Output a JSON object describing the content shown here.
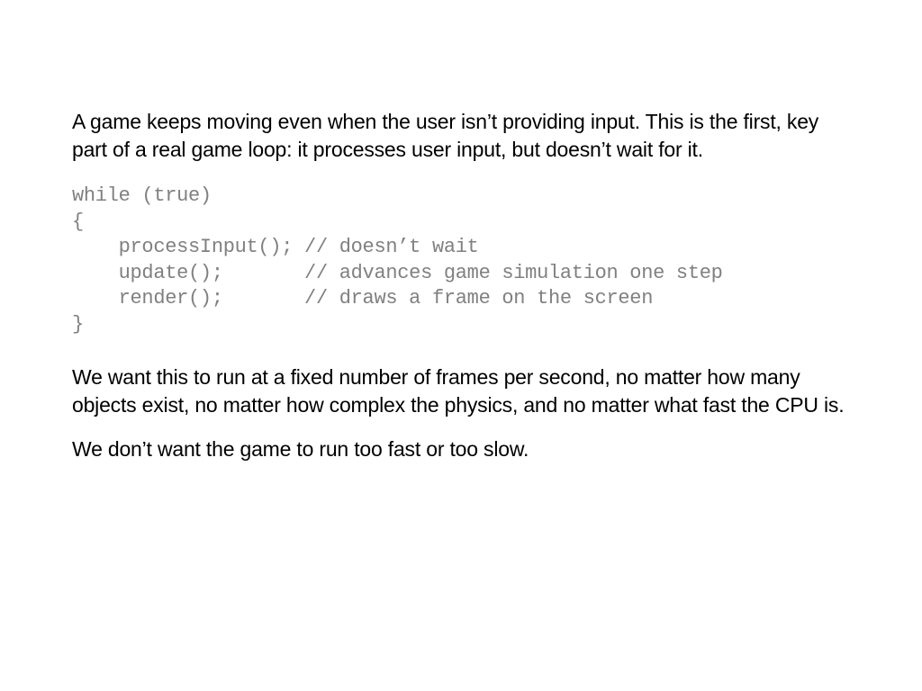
{
  "para1": "A game keeps moving even when the user isn’t providing input.  This is the first, key part of a real game loop: it processes user input, but doesn’t wait for it.",
  "code": "while (true)\n{\n    processInput(); // doesn’t wait\n    update();       // advances game simulation one step\n    render();       // draws a frame on the screen\n}",
  "para2": "We want this to run at a fixed number of frames per second, no matter how many objects exist, no matter how complex the physics, and no matter what fast the CPU is.",
  "para3": "We don’t want the game to run too fast or too slow."
}
